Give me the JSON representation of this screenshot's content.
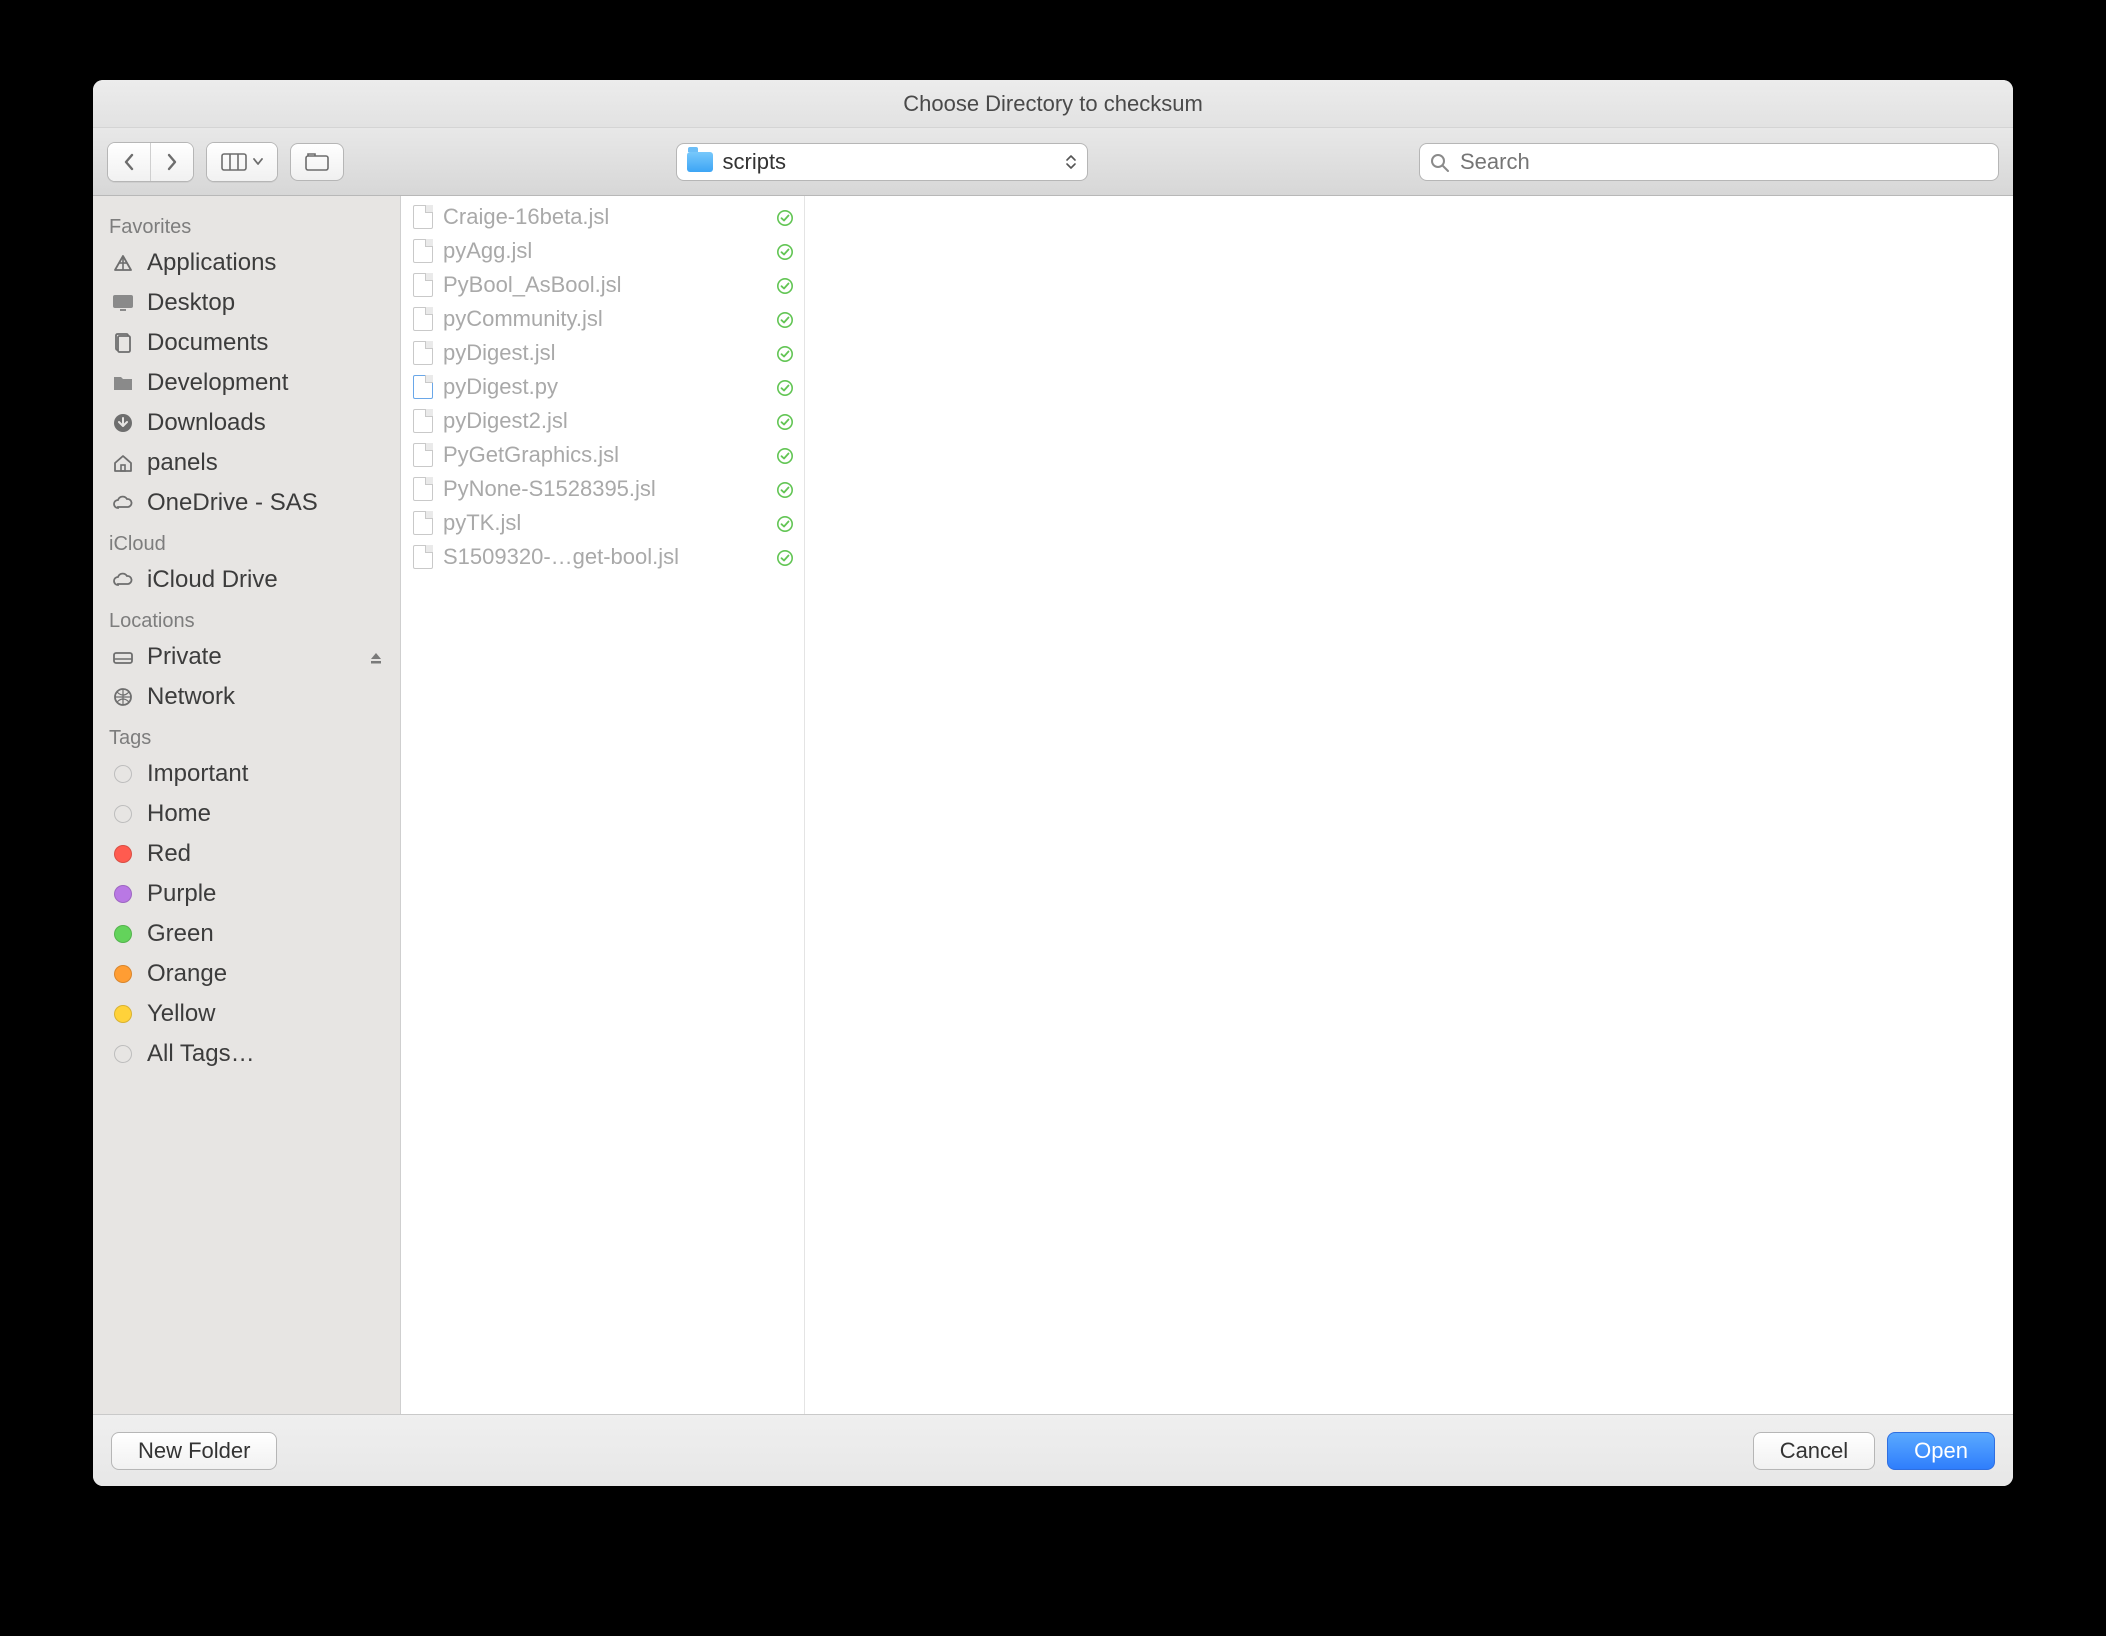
{
  "dialog": {
    "title": "Choose Directory to checksum",
    "current_folder": "scripts",
    "search_placeholder": "Search"
  },
  "sidebar": {
    "sections": [
      {
        "header": "Favorites",
        "items": [
          {
            "name": "applications",
            "label": "Applications",
            "icon": "apps"
          },
          {
            "name": "desktop",
            "label": "Desktop",
            "icon": "desktop"
          },
          {
            "name": "documents",
            "label": "Documents",
            "icon": "documents"
          },
          {
            "name": "development",
            "label": "Development",
            "icon": "folder"
          },
          {
            "name": "downloads",
            "label": "Downloads",
            "icon": "downloads"
          },
          {
            "name": "panels",
            "label": "panels",
            "icon": "home"
          },
          {
            "name": "onedrive",
            "label": "OneDrive - SAS",
            "icon": "cloud"
          }
        ]
      },
      {
        "header": "iCloud",
        "items": [
          {
            "name": "icloud-drive",
            "label": "iCloud Drive",
            "icon": "cloud"
          }
        ]
      },
      {
        "header": "Locations",
        "items": [
          {
            "name": "private",
            "label": "Private",
            "icon": "drive",
            "eject": true
          },
          {
            "name": "network",
            "label": "Network",
            "icon": "globe"
          }
        ]
      },
      {
        "header": "Tags",
        "items": [
          {
            "name": "tag-important",
            "label": "Important",
            "icon": "tag",
            "color": "transparent",
            "border": "#bdbdbd"
          },
          {
            "name": "tag-home",
            "label": "Home",
            "icon": "tag",
            "color": "transparent",
            "border": "#bdbdbd"
          },
          {
            "name": "tag-red",
            "label": "Red",
            "icon": "tag",
            "color": "#ff5b4f"
          },
          {
            "name": "tag-purple",
            "label": "Purple",
            "icon": "tag",
            "color": "#b978e4"
          },
          {
            "name": "tag-green",
            "label": "Green",
            "icon": "tag",
            "color": "#63d35b"
          },
          {
            "name": "tag-orange",
            "label": "Orange",
            "icon": "tag",
            "color": "#ff9d33"
          },
          {
            "name": "tag-yellow",
            "label": "Yellow",
            "icon": "tag",
            "color": "#ffd23a"
          },
          {
            "name": "tag-all",
            "label": "All Tags…",
            "icon": "tag",
            "color": "transparent",
            "border": "#bdbdbd"
          }
        ]
      }
    ]
  },
  "files": [
    {
      "name": "Craige-16beta.jsl",
      "type": "jsl",
      "status": "synced"
    },
    {
      "name": "pyAgg.jsl",
      "type": "jsl",
      "status": "synced"
    },
    {
      "name": "PyBool_AsBool.jsl",
      "type": "jsl",
      "status": "synced"
    },
    {
      "name": "pyCommunity.jsl",
      "type": "jsl",
      "status": "synced"
    },
    {
      "name": "pyDigest.jsl",
      "type": "jsl",
      "status": "synced"
    },
    {
      "name": "pyDigest.py",
      "type": "py",
      "status": "synced"
    },
    {
      "name": "pyDigest2.jsl",
      "type": "jsl",
      "status": "synced"
    },
    {
      "name": "PyGetGraphics.jsl",
      "type": "jsl",
      "status": "synced"
    },
    {
      "name": "PyNone-S1528395.jsl",
      "type": "jsl",
      "status": "synced"
    },
    {
      "name": "pyTK.jsl",
      "type": "jsl",
      "status": "synced"
    },
    {
      "name": "S1509320-…get-bool.jsl",
      "type": "jsl",
      "status": "synced"
    }
  ],
  "footer": {
    "new_folder": "New Folder",
    "cancel": "Cancel",
    "open": "Open"
  }
}
